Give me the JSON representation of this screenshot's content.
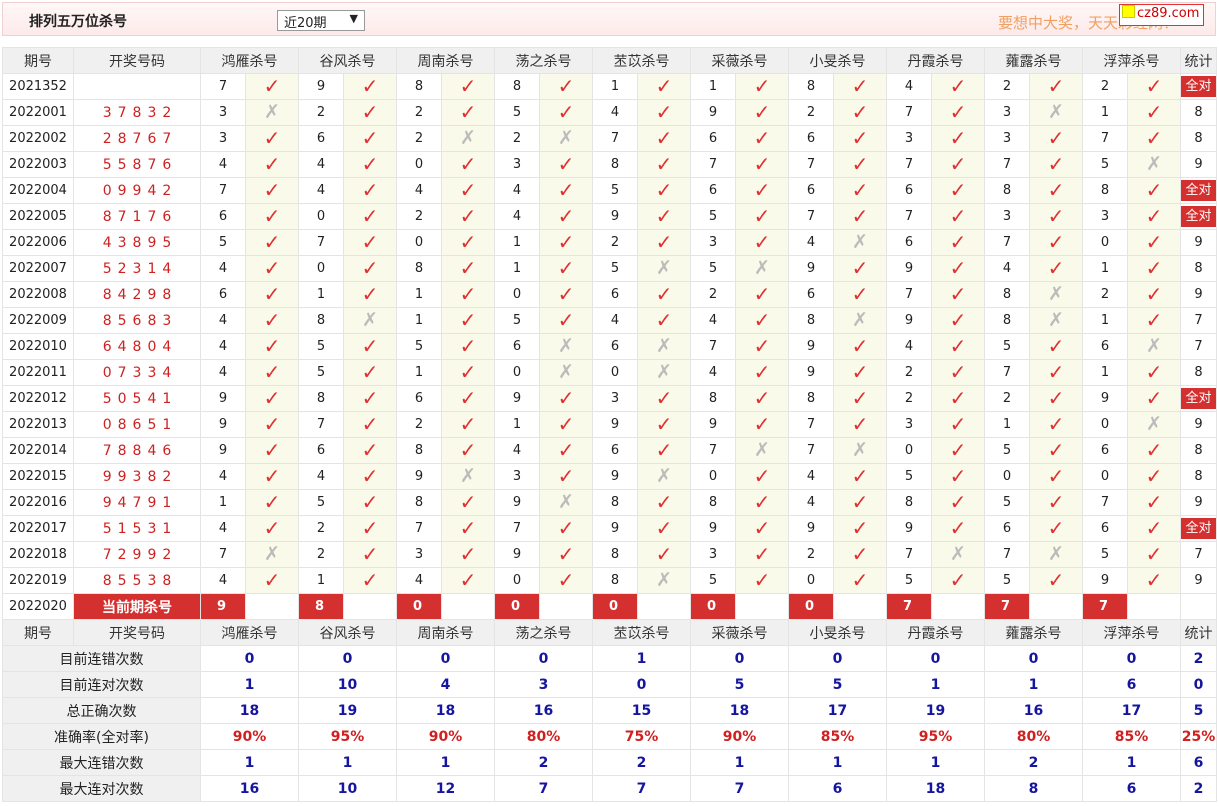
{
  "header": {
    "title": "排列五万位杀号",
    "select_value": "近20期",
    "slogan": "要想中大奖，天天彩经网！",
    "logo": "cz89.com"
  },
  "columns": {
    "period": "期号",
    "draw": "开奖号码",
    "experts": [
      "鸿雁杀号",
      "谷风杀号",
      "周南杀号",
      "荡之杀号",
      "苤苡杀号",
      "采薇杀号",
      "小旻杀号",
      "丹霞杀号",
      "蕹露杀号",
      "浮萍杀号"
    ],
    "stat": "统计"
  },
  "rows": [
    {
      "period": "2021352",
      "draw": "",
      "kills": [
        "7",
        "9",
        "8",
        "8",
        "1",
        "1",
        "8",
        "4",
        "2",
        "2"
      ],
      "marks": [
        "✓",
        "✓",
        "✓",
        "✓",
        "✓",
        "✓",
        "✓",
        "✓",
        "✓",
        "✓"
      ],
      "stat": "全对"
    },
    {
      "period": "2022001",
      "draw": "37832",
      "kills": [
        "3",
        "2",
        "2",
        "5",
        "4",
        "9",
        "2",
        "7",
        "3",
        "1"
      ],
      "marks": [
        "✗",
        "✓",
        "✓",
        "✓",
        "✓",
        "✓",
        "✓",
        "✓",
        "✗",
        "✓"
      ],
      "stat": "8"
    },
    {
      "period": "2022002",
      "draw": "28767",
      "kills": [
        "3",
        "6",
        "2",
        "2",
        "7",
        "6",
        "6",
        "3",
        "3",
        "7"
      ],
      "marks": [
        "✓",
        "✓",
        "✗",
        "✗",
        "✓",
        "✓",
        "✓",
        "✓",
        "✓",
        "✓"
      ],
      "stat": "8"
    },
    {
      "period": "2022003",
      "draw": "55876",
      "kills": [
        "4",
        "4",
        "0",
        "3",
        "8",
        "7",
        "7",
        "7",
        "7",
        "5"
      ],
      "marks": [
        "✓",
        "✓",
        "✓",
        "✓",
        "✓",
        "✓",
        "✓",
        "✓",
        "✓",
        "✗"
      ],
      "stat": "9"
    },
    {
      "period": "2022004",
      "draw": "09942",
      "kills": [
        "7",
        "4",
        "4",
        "4",
        "5",
        "6",
        "6",
        "6",
        "8",
        "8"
      ],
      "marks": [
        "✓",
        "✓",
        "✓",
        "✓",
        "✓",
        "✓",
        "✓",
        "✓",
        "✓",
        "✓"
      ],
      "stat": "全对"
    },
    {
      "period": "2022005",
      "draw": "87176",
      "kills": [
        "6",
        "0",
        "2",
        "4",
        "9",
        "5",
        "7",
        "7",
        "3",
        "3"
      ],
      "marks": [
        "✓",
        "✓",
        "✓",
        "✓",
        "✓",
        "✓",
        "✓",
        "✓",
        "✓",
        "✓"
      ],
      "stat": "全对"
    },
    {
      "period": "2022006",
      "draw": "43895",
      "kills": [
        "5",
        "7",
        "0",
        "1",
        "2",
        "3",
        "4",
        "6",
        "7",
        "0"
      ],
      "marks": [
        "✓",
        "✓",
        "✓",
        "✓",
        "✓",
        "✓",
        "✗",
        "✓",
        "✓",
        "✓"
      ],
      "stat": "9"
    },
    {
      "period": "2022007",
      "draw": "52314",
      "kills": [
        "4",
        "0",
        "8",
        "1",
        "5",
        "5",
        "9",
        "9",
        "4",
        "1"
      ],
      "marks": [
        "✓",
        "✓",
        "✓",
        "✓",
        "✗",
        "✗",
        "✓",
        "✓",
        "✓",
        "✓"
      ],
      "stat": "8"
    },
    {
      "period": "2022008",
      "draw": "84298",
      "kills": [
        "6",
        "1",
        "1",
        "0",
        "6",
        "2",
        "6",
        "7",
        "8",
        "2"
      ],
      "marks": [
        "✓",
        "✓",
        "✓",
        "✓",
        "✓",
        "✓",
        "✓",
        "✓",
        "✗",
        "✓"
      ],
      "stat": "9"
    },
    {
      "period": "2022009",
      "draw": "85683",
      "kills": [
        "4",
        "8",
        "1",
        "5",
        "4",
        "4",
        "8",
        "9",
        "8",
        "1"
      ],
      "marks": [
        "✓",
        "✗",
        "✓",
        "✓",
        "✓",
        "✓",
        "✗",
        "✓",
        "✗",
        "✓"
      ],
      "stat": "7"
    },
    {
      "period": "2022010",
      "draw": "64804",
      "kills": [
        "4",
        "5",
        "5",
        "6",
        "6",
        "7",
        "9",
        "4",
        "5",
        "6"
      ],
      "marks": [
        "✓",
        "✓",
        "✓",
        "✗",
        "✗",
        "✓",
        "✓",
        "✓",
        "✓",
        "✗"
      ],
      "stat": "7"
    },
    {
      "period": "2022011",
      "draw": "07334",
      "kills": [
        "4",
        "5",
        "1",
        "0",
        "0",
        "4",
        "9",
        "2",
        "7",
        "1"
      ],
      "marks": [
        "✓",
        "✓",
        "✓",
        "✗",
        "✗",
        "✓",
        "✓",
        "✓",
        "✓",
        "✓"
      ],
      "stat": "8"
    },
    {
      "period": "2022012",
      "draw": "50541",
      "kills": [
        "9",
        "8",
        "6",
        "9",
        "3",
        "8",
        "8",
        "2",
        "2",
        "9"
      ],
      "marks": [
        "✓",
        "✓",
        "✓",
        "✓",
        "✓",
        "✓",
        "✓",
        "✓",
        "✓",
        "✓"
      ],
      "stat": "全对"
    },
    {
      "period": "2022013",
      "draw": "08651",
      "kills": [
        "9",
        "7",
        "2",
        "1",
        "9",
        "9",
        "7",
        "3",
        "1",
        "0"
      ],
      "marks": [
        "✓",
        "✓",
        "✓",
        "✓",
        "✓",
        "✓",
        "✓",
        "✓",
        "✓",
        "✗"
      ],
      "stat": "9"
    },
    {
      "period": "2022014",
      "draw": "78846",
      "kills": [
        "9",
        "6",
        "8",
        "4",
        "6",
        "7",
        "7",
        "0",
        "5",
        "6"
      ],
      "marks": [
        "✓",
        "✓",
        "✓",
        "✓",
        "✓",
        "✗",
        "✗",
        "✓",
        "✓",
        "✓"
      ],
      "stat": "8"
    },
    {
      "period": "2022015",
      "draw": "99382",
      "kills": [
        "4",
        "4",
        "9",
        "3",
        "9",
        "0",
        "4",
        "5",
        "0",
        "0"
      ],
      "marks": [
        "✓",
        "✓",
        "✗",
        "✓",
        "✗",
        "✓",
        "✓",
        "✓",
        "✓",
        "✓"
      ],
      "stat": "8"
    },
    {
      "period": "2022016",
      "draw": "94791",
      "kills": [
        "1",
        "5",
        "8",
        "9",
        "8",
        "8",
        "4",
        "8",
        "5",
        "7"
      ],
      "marks": [
        "✓",
        "✓",
        "✓",
        "✗",
        "✓",
        "✓",
        "✓",
        "✓",
        "✓",
        "✓"
      ],
      "stat": "9"
    },
    {
      "period": "2022017",
      "draw": "51531",
      "kills": [
        "4",
        "2",
        "7",
        "7",
        "9",
        "9",
        "9",
        "9",
        "6",
        "6"
      ],
      "marks": [
        "✓",
        "✓",
        "✓",
        "✓",
        "✓",
        "✓",
        "✓",
        "✓",
        "✓",
        "✓"
      ],
      "stat": "全对"
    },
    {
      "period": "2022018",
      "draw": "72992",
      "kills": [
        "7",
        "2",
        "3",
        "9",
        "8",
        "3",
        "2",
        "7",
        "7",
        "5"
      ],
      "marks": [
        "✗",
        "✓",
        "✓",
        "✓",
        "✓",
        "✓",
        "✓",
        "✗",
        "✗",
        "✓"
      ],
      "stat": "7"
    },
    {
      "period": "2022019",
      "draw": "85538",
      "kills": [
        "4",
        "1",
        "4",
        "0",
        "8",
        "5",
        "0",
        "5",
        "5",
        "9"
      ],
      "marks": [
        "✓",
        "✓",
        "✓",
        "✓",
        "✗",
        "✓",
        "✓",
        "✓",
        "✓",
        "✓"
      ],
      "stat": "9"
    }
  ],
  "current": {
    "period": "2022020",
    "label": "当前期杀号",
    "kills": [
      "9",
      "8",
      "0",
      "0",
      "0",
      "0",
      "0",
      "7",
      "7",
      "7"
    ]
  },
  "stats": [
    {
      "label": "目前连错次数",
      "values": [
        "0",
        "0",
        "0",
        "0",
        "1",
        "0",
        "0",
        "0",
        "0",
        "0"
      ],
      "stat": "2"
    },
    {
      "label": "目前连对次数",
      "values": [
        "1",
        "10",
        "4",
        "3",
        "0",
        "5",
        "5",
        "1",
        "1",
        "6"
      ],
      "stat": "0"
    },
    {
      "label": "总正确次数",
      "values": [
        "18",
        "19",
        "18",
        "16",
        "15",
        "18",
        "17",
        "19",
        "16",
        "17"
      ],
      "stat": "5"
    },
    {
      "label": "准确率(全对率)",
      "values": [
        "90%",
        "95%",
        "90%",
        "80%",
        "75%",
        "90%",
        "85%",
        "95%",
        "80%",
        "85%"
      ],
      "stat": "25%"
    },
    {
      "label": "最大连错次数",
      "values": [
        "1",
        "1",
        "1",
        "2",
        "2",
        "1",
        "1",
        "1",
        "2",
        "1"
      ],
      "stat": "6"
    },
    {
      "label": "最大连对次数",
      "values": [
        "16",
        "10",
        "12",
        "7",
        "7",
        "7",
        "6",
        "18",
        "8",
        "6"
      ],
      "stat": "2"
    }
  ]
}
